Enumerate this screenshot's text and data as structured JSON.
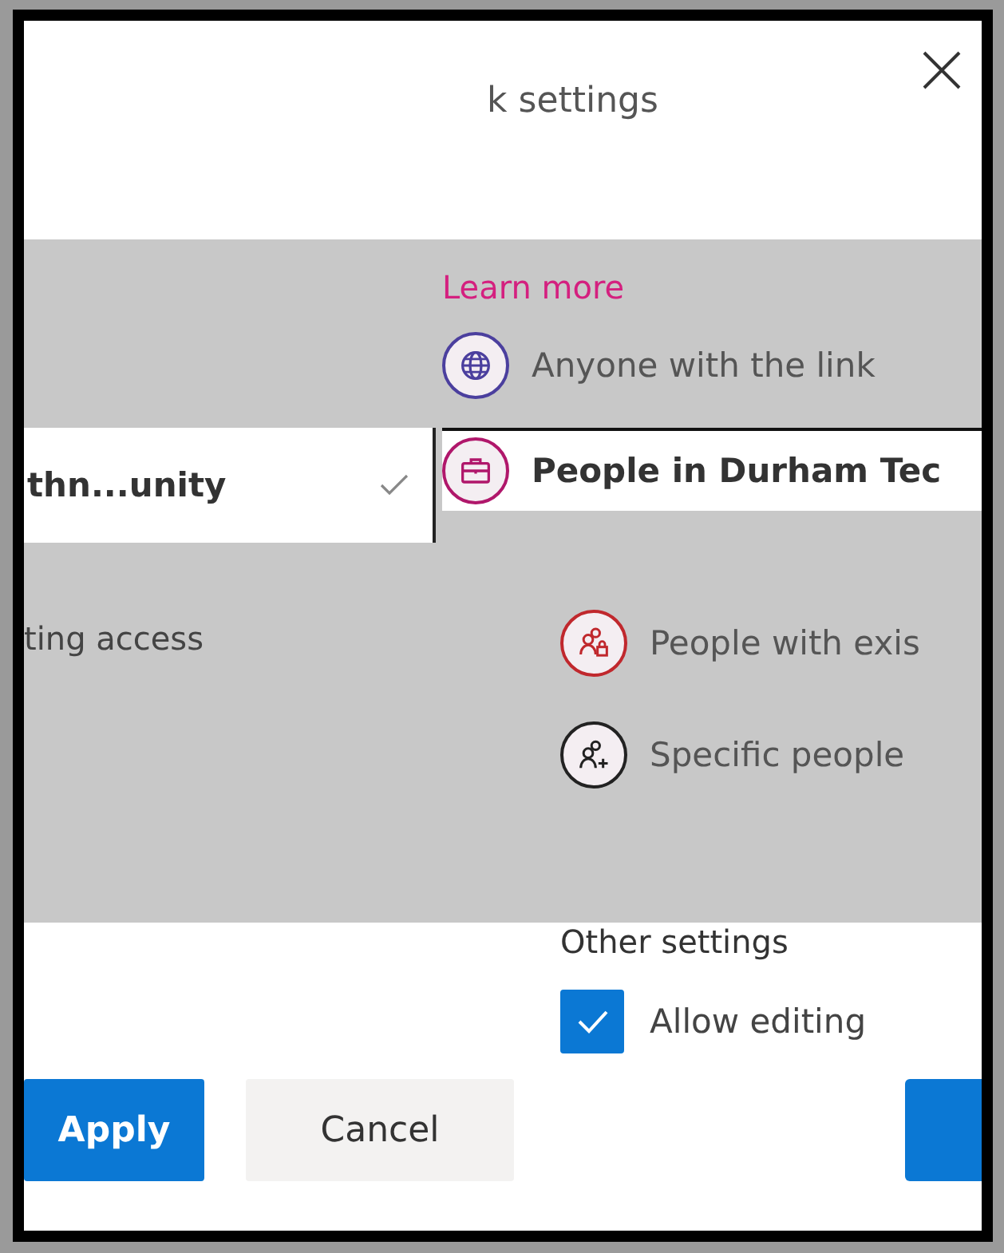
{
  "dialog": {
    "title": "k settings"
  },
  "left": {
    "selected_item": {
      "label": "thn...unity",
      "selected": true
    },
    "access_text": "ting access"
  },
  "learn_more": "Learn more",
  "options": [
    {
      "label": "Anyone with the link",
      "kind": "globe",
      "selected": false
    },
    {
      "label": "People in Durham Tec",
      "kind": "briefcase",
      "selected": true
    },
    {
      "label": "People with exis",
      "kind": "people-lock",
      "selected": false
    },
    {
      "label": "Specific people",
      "kind": "people-add",
      "selected": false
    }
  ],
  "other_settings": {
    "heading": "Other settings",
    "items": [
      {
        "label": "Allow editing",
        "checked": true
      }
    ]
  },
  "buttons": [
    {
      "label": "Apply",
      "kind": "primary"
    },
    {
      "label": "Cancel",
      "kind": "secondary"
    },
    {
      "kind": "primary-cut"
    }
  ]
}
